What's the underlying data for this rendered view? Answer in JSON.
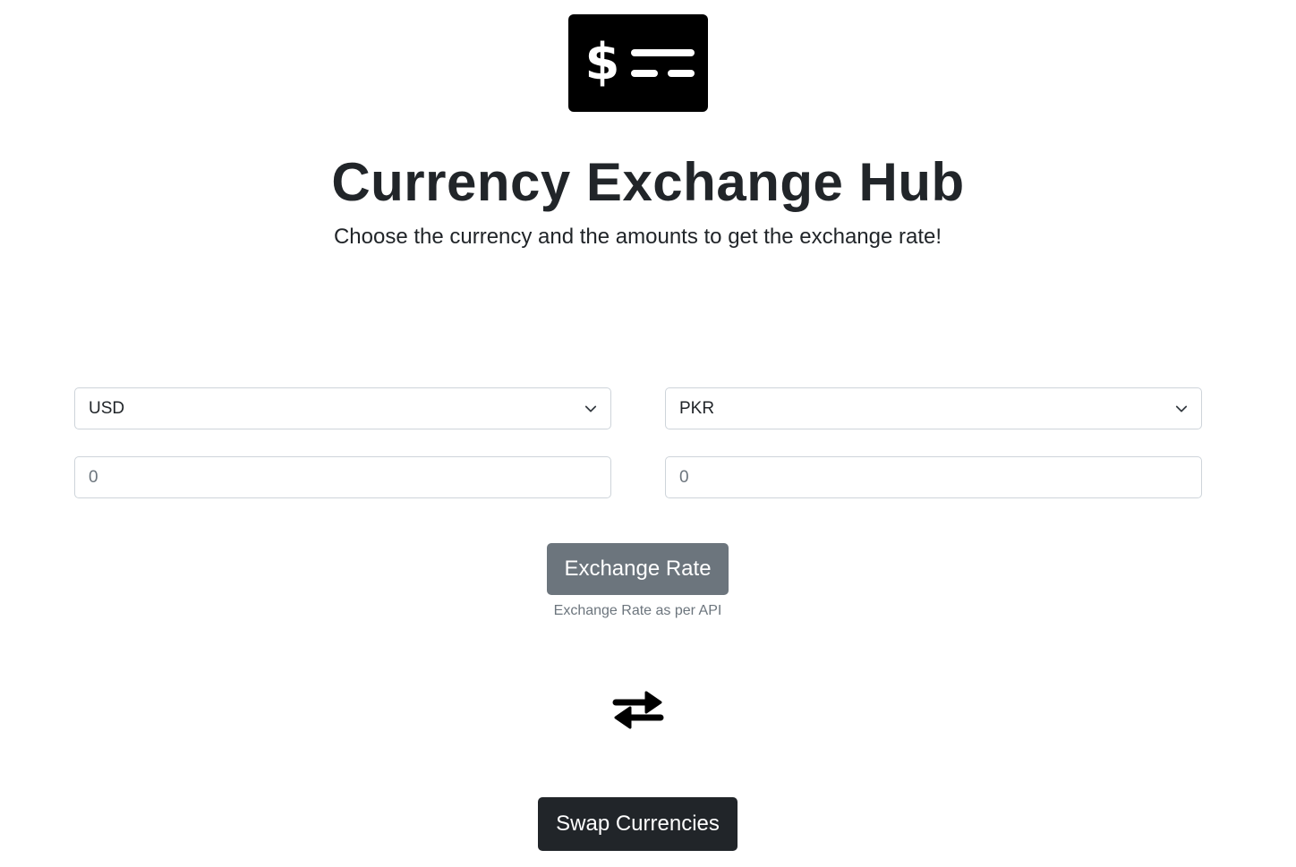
{
  "header": {
    "logo_icon": "money-bill-dollar-icon",
    "title": "Currency Exchange Hub",
    "subtitle": "Choose the currency and the amounts to get the exchange rate!"
  },
  "converter": {
    "from_currency": "USD",
    "to_currency": "PKR",
    "from_amount_placeholder": "0",
    "to_amount_placeholder": "0",
    "dropdown_icon": "chevron-down-icon"
  },
  "actions": {
    "exchange_rate_label": "Exchange Rate",
    "exchange_rate_note": "Exchange Rate as per API",
    "swap_icon": "exchange-arrows-icon",
    "swap_label": "Swap Currencies"
  },
  "colors": {
    "logo_bg": "#000000",
    "text": "#212529",
    "secondary_button": "#6c757d",
    "dark_button": "#212529",
    "input_border": "#ced4da"
  }
}
